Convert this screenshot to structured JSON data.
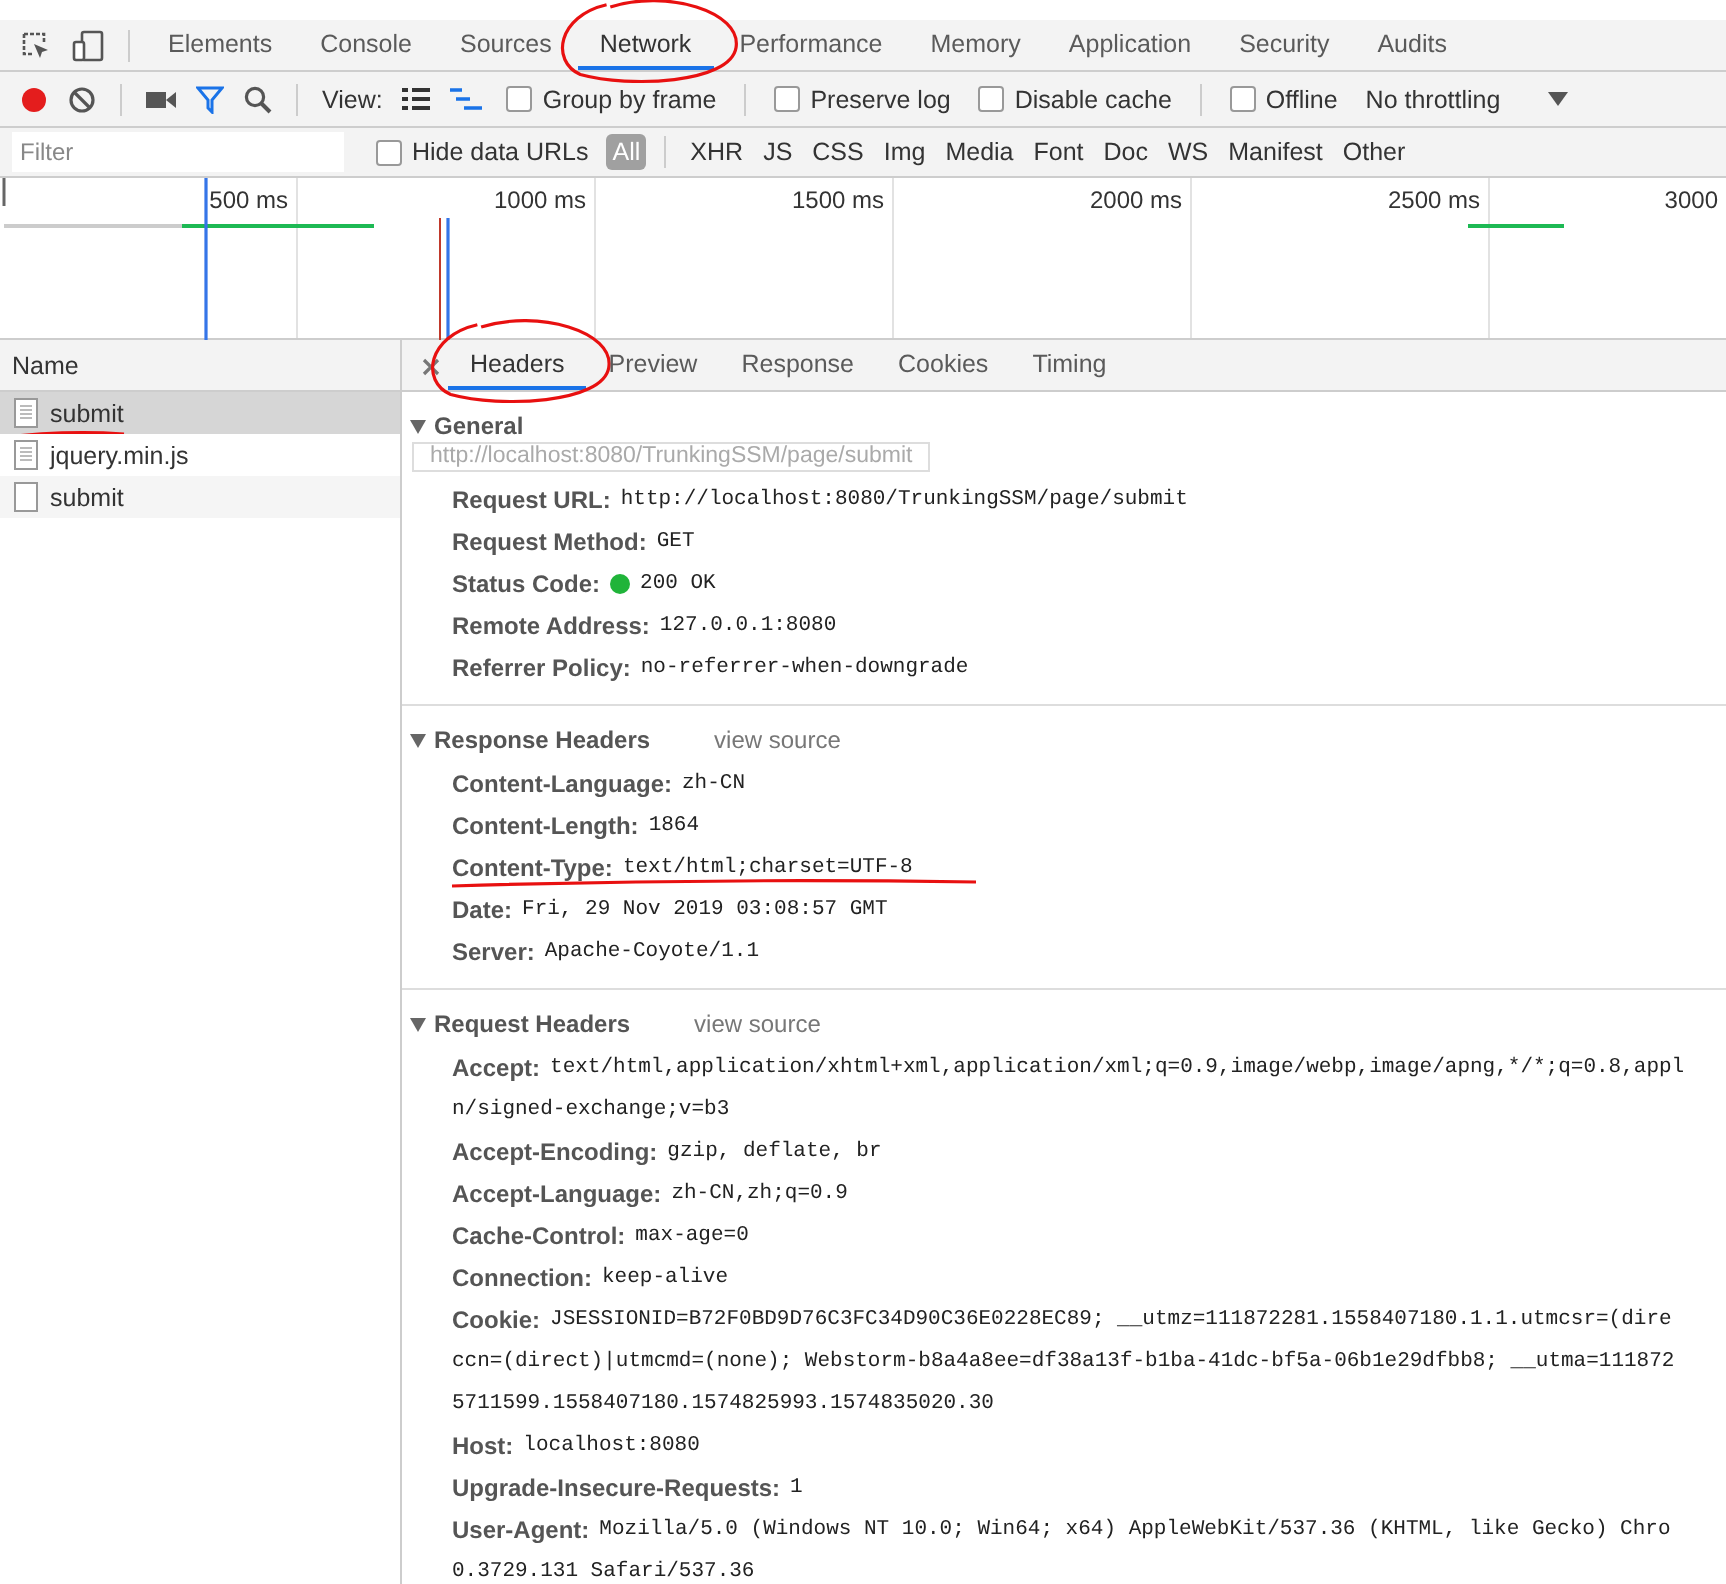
{
  "main_tabs": [
    {
      "label": "Elements",
      "selected": false,
      "circled": false
    },
    {
      "label": "Console",
      "selected": false,
      "circled": false
    },
    {
      "label": "Sources",
      "selected": false,
      "circled": false
    },
    {
      "label": "Network",
      "selected": true,
      "circled": true
    },
    {
      "label": "Performance",
      "selected": false,
      "circled": false
    },
    {
      "label": "Memory",
      "selected": false,
      "circled": false
    },
    {
      "label": "Application",
      "selected": false,
      "circled": false
    },
    {
      "label": "Security",
      "selected": false,
      "circled": false
    },
    {
      "label": "Audits",
      "selected": false,
      "circled": false
    }
  ],
  "toolbar": {
    "recording": true,
    "filter_active": true,
    "view_label": "View:",
    "large_rows": false,
    "waterfall": true,
    "checkbox_groups": [
      [
        {
          "label": "Group by frame",
          "checked": false
        }
      ],
      [
        {
          "label": "Preserve log",
          "checked": false
        },
        {
          "label": "Disable cache",
          "checked": false
        }
      ],
      [
        {
          "label": "Offline",
          "checked": false
        }
      ]
    ],
    "throttling": "No throttling"
  },
  "filter_bar": {
    "placeholder": "Filter",
    "hide_data_urls": {
      "label": "Hide data URLs",
      "checked": false
    },
    "types": [
      {
        "label": "All",
        "selected": true
      },
      {
        "label": "XHR",
        "selected": false
      },
      {
        "label": "JS",
        "selected": false
      },
      {
        "label": "CSS",
        "selected": false
      },
      {
        "label": "Img",
        "selected": false
      },
      {
        "label": "Media",
        "selected": false
      },
      {
        "label": "Font",
        "selected": false
      },
      {
        "label": "Doc",
        "selected": false
      },
      {
        "label": "WS",
        "selected": false
      },
      {
        "label": "Manifest",
        "selected": false
      },
      {
        "label": "Other",
        "selected": false
      }
    ]
  },
  "timeline": {
    "ticks": [
      "500 ms",
      "1000 ms",
      "1500 ms",
      "2000 ms",
      "2500 ms",
      "3000"
    ]
  },
  "requests": {
    "column": "Name",
    "rows": [
      {
        "name": "submit",
        "kind": "document",
        "selected": true,
        "underlined": true
      },
      {
        "name": "jquery.min.js",
        "kind": "document",
        "selected": false,
        "underlined": false
      },
      {
        "name": "submit",
        "kind": "blank",
        "selected": false,
        "underlined": false
      }
    ],
    "tooltip": "http://localhost:8080/TrunkingSSM/page/submit"
  },
  "detail_tabs": [
    {
      "label": "Headers",
      "selected": true,
      "circled": true
    },
    {
      "label": "Preview",
      "selected": false,
      "circled": false
    },
    {
      "label": "Response",
      "selected": false,
      "circled": false
    },
    {
      "label": "Cookies",
      "selected": false,
      "circled": false
    },
    {
      "label": "Timing",
      "selected": false,
      "circled": false
    }
  ],
  "sections": [
    {
      "title": "General",
      "expanded": true,
      "rows": [
        {
          "name": "Request URL:",
          "lines": [
            "http://localhost:8080/TrunkingSSM/page/submit"
          ]
        },
        {
          "name": "Request Method:",
          "lines": [
            "GET"
          ]
        },
        {
          "name": "Status Code:",
          "lines": [
            "200 OK"
          ],
          "color": "#20b43a"
        },
        {
          "name": "Remote Address:",
          "lines": [
            "127.0.0.1:8080"
          ]
        },
        {
          "name": "Referrer Policy:",
          "lines": [
            "no-referrer-when-downgrade"
          ]
        }
      ]
    },
    {
      "title": "Response Headers",
      "expanded": true,
      "link": "view source",
      "rows": [
        {
          "name": "Content-Language:",
          "lines": [
            "zh-CN"
          ]
        },
        {
          "name": "Content-Length:",
          "lines": [
            "1864"
          ]
        },
        {
          "name": "Content-Type:",
          "lines": [
            "text/html;charset=UTF-8"
          ],
          "underlined": true
        },
        {
          "name": "Date:",
          "lines": [
            "Fri, 29 Nov 2019 03:08:57 GMT"
          ]
        },
        {
          "name": "Server:",
          "lines": [
            "Apache-Coyote/1.1"
          ]
        }
      ]
    },
    {
      "title": "Request Headers",
      "expanded": true,
      "link": "view source",
      "rows": [
        {
          "name": "Accept:",
          "lines": [
            "text/html,application/xhtml+xml,application/xml;q=0.9,image/webp,image/apng,*/*;q=0.8,appl",
            "n/signed-exchange;v=b3"
          ]
        },
        {
          "name": "Accept-Encoding:",
          "lines": [
            "gzip, deflate, br"
          ]
        },
        {
          "name": "Accept-Language:",
          "lines": [
            "zh-CN,zh;q=0.9"
          ]
        },
        {
          "name": "Cache-Control:",
          "lines": [
            "max-age=0"
          ]
        },
        {
          "name": "Connection:",
          "lines": [
            "keep-alive"
          ]
        },
        {
          "name": "Cookie:",
          "lines": [
            "JSESSIONID=B72F0BD9D76C3FC34D90C36E0228EC89; __utmz=111872281.1558407180.1.1.utmcsr=(dire",
            "ccn=(direct)|utmcmd=(none); Webstorm-b8a4a8ee=df38a13f-b1ba-41dc-bf5a-06b1e29dfbb8; __utma=111872",
            "5711599.1558407180.1574825993.1574835020.30"
          ]
        },
        {
          "name": "Host:",
          "lines": [
            "localhost:8080"
          ]
        },
        {
          "name": "Upgrade-Insecure-Requests:",
          "lines": [
            "1"
          ]
        },
        {
          "name": "User-Agent:",
          "lines": [
            "Mozilla/5.0 (Windows NT 10.0; Win64; x64) AppleWebKit/537.36 (KHTML, like Gecko) Chro",
            "0.3729.131 Safari/537.36"
          ]
        }
      ]
    }
  ]
}
